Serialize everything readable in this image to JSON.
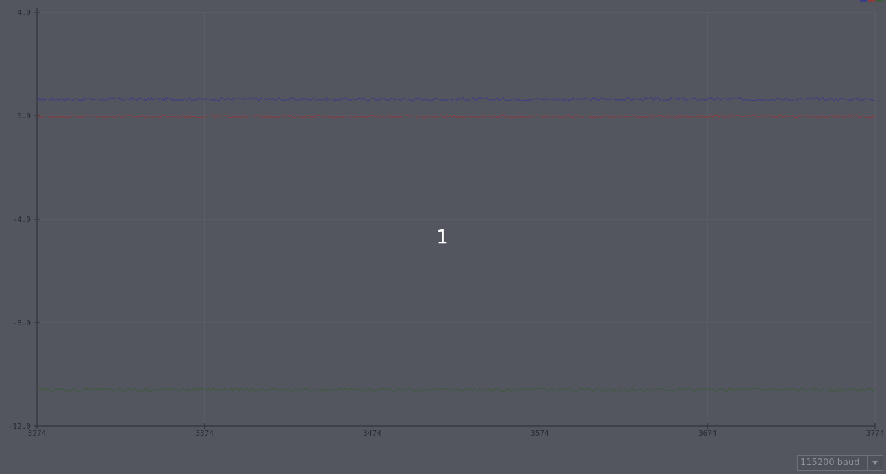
{
  "window": {
    "overlay_label": "1"
  },
  "baud": {
    "selected": "115200 baud"
  },
  "colors": {
    "background": "#53565e",
    "grid": "#5d6068",
    "axis": "#2a2c31",
    "series": [
      "#3b3c86",
      "#8a3a3e",
      "#3c5a3c"
    ]
  },
  "chart_data": {
    "type": "line",
    "xlim": [
      3274,
      3774
    ],
    "ylim": [
      -12.0,
      4.0
    ],
    "xticks": [
      3274,
      3374,
      3474,
      3574,
      3674,
      3774
    ],
    "yticks": [
      4.0,
      0.0,
      -4.0,
      -8.0,
      -12.0
    ],
    "xtick_labels": [
      "3274",
      "3374",
      "3474",
      "3574",
      "3674",
      "3774"
    ],
    "ytick_labels": [
      "4.0",
      "0.0",
      "-4.0",
      "-8.0",
      "-12.0"
    ],
    "grid": true,
    "legend": "top-right",
    "series": [
      {
        "color": "#3b3c86",
        "mean": 0.64,
        "noise": 0.06
      },
      {
        "color": "#8a3a3e",
        "mean": -0.03,
        "noise": 0.05
      },
      {
        "color": "#3c5a3c",
        "mean": -10.6,
        "noise": 0.07
      }
    ]
  }
}
